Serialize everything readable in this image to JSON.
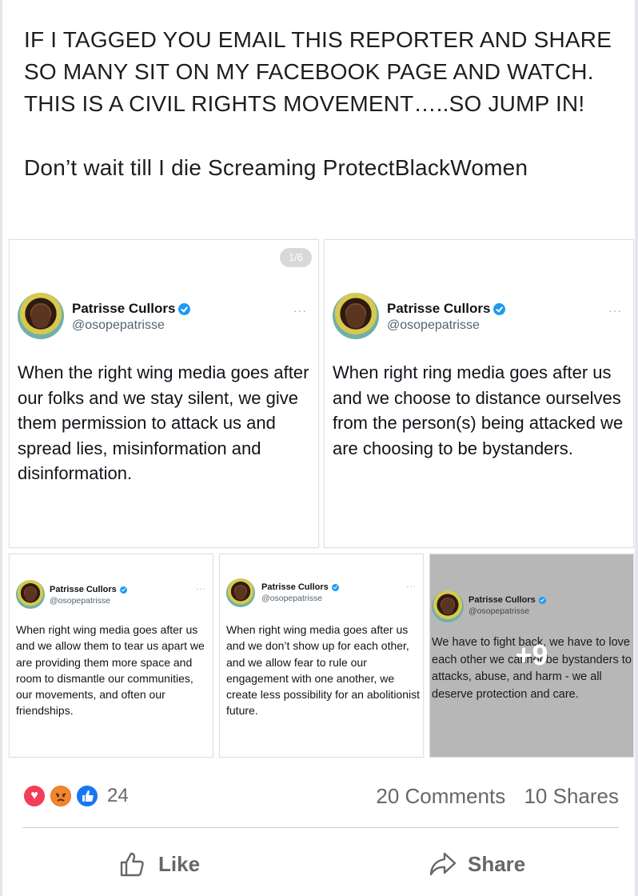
{
  "post": {
    "text_line1": "IF I TAGGED YOU EMAIL THIS REPORTER AND SHARE SO MANY SIT ON MY FACEBOOK PAGE AND WATCH. THIS IS A CIVIL RIGHTS MOVEMENT…..SO JUMP IN!",
    "text_line2": "Don’t wait till I die Screaming ProtectBlackWomen"
  },
  "gallery": {
    "counter": "1/6",
    "more_count": "+9",
    "tweets": [
      {
        "name": "Patrisse Cullors",
        "handle": "@osopepatrisse",
        "text": "When the right wing media goes after our folks and we stay silent, we give them permission to attack us and spread lies, misinformation and disinformation."
      },
      {
        "name": "Patrisse Cullors",
        "handle": "@osopepatrisse",
        "text": "When right ring media goes after us and we choose to distance ourselves from the person(s) being attacked we are choosing to be bystanders."
      },
      {
        "name": "Patrisse Cullors",
        "handle": "@osopepatrisse",
        "text": "When right wing media goes after us and we allow them to tear us apart we are providing them more space and room to dismantle our communities, our movements, and often our friendships."
      },
      {
        "name": "Patrisse Cullors",
        "handle": "@osopepatrisse",
        "text": "When right wing media goes after us and we don’t show up for each other, and we allow fear to rule our engagement with one another, we create less possibility for an abolitionist future."
      },
      {
        "name": "Patrisse Cullors",
        "handle": "@osopepatrisse",
        "text": "We have to fight back, we have to love each other we cannot be bystanders to attacks, abuse, and harm - we all deserve protection and care."
      }
    ]
  },
  "engagement": {
    "reaction_count": "24",
    "reaction_icons": [
      "love-reaction-icon",
      "angry-reaction-icon",
      "like-reaction-icon"
    ],
    "comments": "20 Comments",
    "shares": "10 Shares"
  },
  "actions": {
    "like_label": "Like",
    "share_label": "Share"
  },
  "colors": {
    "facebook_blue": "#1877f2",
    "love_red": "#f33e58",
    "verified_blue": "#1d9bf0",
    "muted_text": "#65676b"
  }
}
